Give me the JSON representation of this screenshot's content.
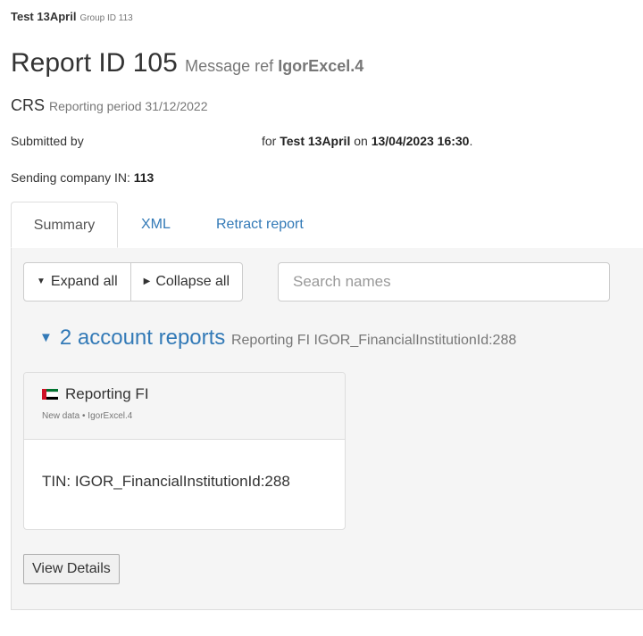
{
  "breadcrumb": {
    "name": "Test 13April",
    "group": "Group ID 113"
  },
  "report": {
    "title": "Report ID 105",
    "message_ref_label": "Message ref",
    "message_ref": "IgorExcel.4",
    "type": "CRS",
    "reporting_period": "Reporting period 31/12/2022"
  },
  "submission": {
    "submitted_by_label": "Submitted by",
    "for_label": "for",
    "for_name": "Test 13April",
    "on_label": "on",
    "datetime": "13/04/2023 16:30",
    "end": "."
  },
  "sending_company": {
    "label": "Sending company IN:",
    "value": "113"
  },
  "tabs": [
    {
      "label": "Summary",
      "active": true
    },
    {
      "label": "XML",
      "active": false
    },
    {
      "label": "Retract report",
      "active": false
    }
  ],
  "toolbar": {
    "expand_label": "Expand all",
    "collapse_label": "Collapse all",
    "search_placeholder": "Search names"
  },
  "accounts": {
    "count_label": "2 account reports",
    "meta": "Reporting FI IGOR_FinancialInstitutionId:288"
  },
  "card": {
    "flag_icon": "uae-flag-icon",
    "title": "Reporting FI",
    "meta": "New data • IgorExcel.4",
    "tin": "TIN: IGOR_FinancialInstitutionId:288"
  },
  "actions": {
    "view_details_label": "View Details"
  },
  "colors": {
    "link": "#337ab7",
    "muted": "#777777",
    "panel_bg": "#f5f5f5",
    "border": "#dddddd"
  }
}
